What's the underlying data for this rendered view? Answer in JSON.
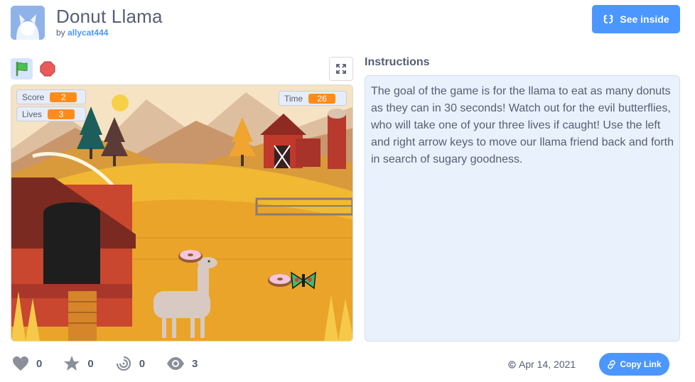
{
  "project": {
    "title": "Donut Llama",
    "by_prefix": "by",
    "author": "allycat444",
    "see_inside_label": "See inside"
  },
  "stage": {
    "monitors": [
      {
        "label": "Score",
        "value": "2"
      },
      {
        "label": "Lives",
        "value": "3"
      },
      {
        "label": "Time",
        "value": "26"
      }
    ]
  },
  "instructions": {
    "heading": "Instructions",
    "text": "The goal of the game is for the llama to eat as many donuts as they can in 30 seconds! Watch out for the evil butterflies, who will take one of your three lives if caught! Use the left and right arrow keys to move our llama friend back and forth in search of sugary goodness."
  },
  "stats": {
    "loves": "0",
    "favorites": "0",
    "remixes": "0",
    "views": "3"
  },
  "footer": {
    "date": "Apr 14, 2021",
    "copy_link_label": "Copy Link"
  },
  "colors": {
    "accent": "#4c97ff",
    "text": "#575e75",
    "monitor_value": "#ff8c1a",
    "instructions_bg": "#e9f1fc"
  },
  "icons": [
    "project-thumbnail",
    "see-inside-icon",
    "green-flag-icon",
    "stop-icon",
    "fullscreen-icon",
    "heart-icon",
    "star-icon",
    "remix-icon",
    "eye-icon",
    "copyright-icon",
    "link-icon"
  ]
}
